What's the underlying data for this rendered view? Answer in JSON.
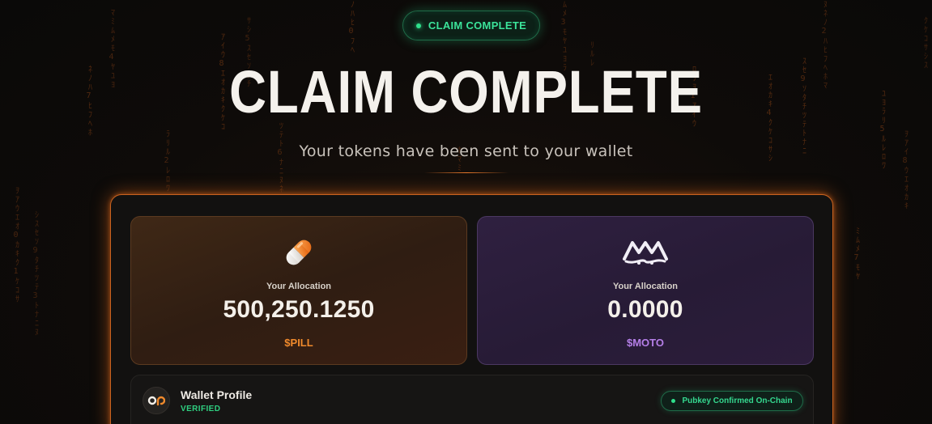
{
  "header": {
    "status_badge": "CLAIM COMPLETE",
    "title": "CLAIM COMPLETE",
    "subtitle": "Your tokens have been sent to your wallet"
  },
  "allocations": [
    {
      "label": "Your Allocation",
      "amount": "500,250.1250",
      "ticker": "$PILL",
      "icon": "pill-icon",
      "accent": "#f08a2c"
    },
    {
      "label": "Your Allocation",
      "amount": "0.0000",
      "ticker": "$MOTO",
      "icon": "moto-logo-icon",
      "accent": "#b57fe8"
    }
  ],
  "wallet": {
    "title": "Wallet Profile",
    "status": "VERIFIED",
    "chip": "Pubkey Confirmed On-Chain",
    "avatar_icon": "op-logo-icon"
  },
  "colors": {
    "panel_border": "#c9621f",
    "success_green": "#2fe08c",
    "background": "#0d0b0a"
  }
}
